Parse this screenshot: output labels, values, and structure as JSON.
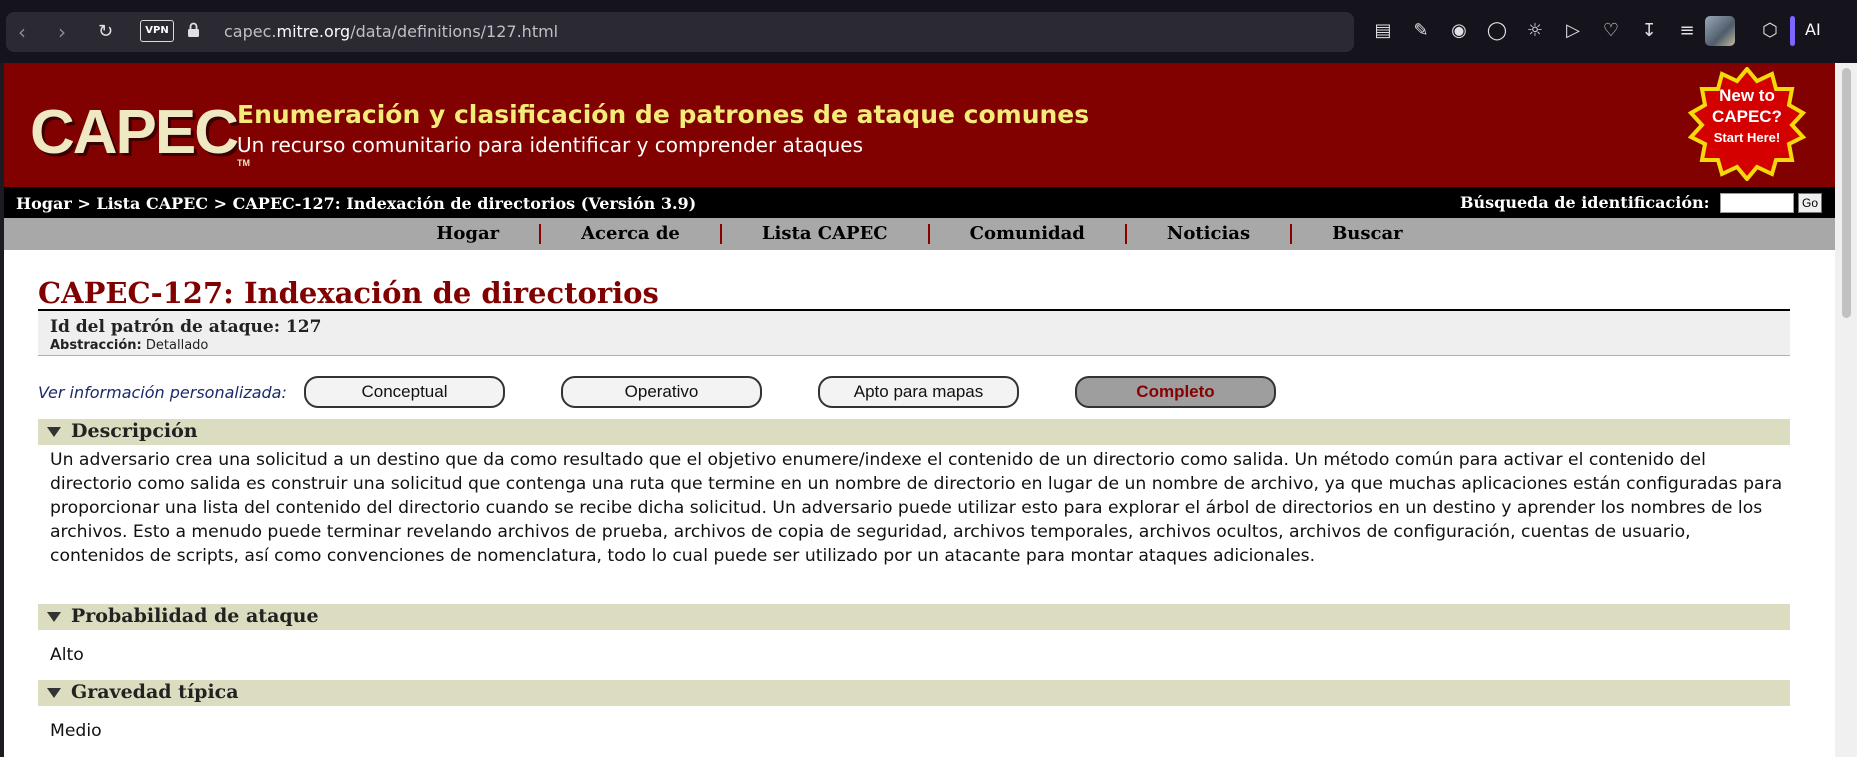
{
  "browser": {
    "url_prefix": "capec.",
    "url_domain": "mitre.org",
    "url_path": "/data/definitions/127.html",
    "vpn_label": "VPN",
    "ai_label": "AI"
  },
  "banner": {
    "logo": "CAPEC",
    "logo_tm": "TM",
    "title": "Enumeración y clasificación de patrones de ataque comunes",
    "subtitle": "Un recurso comunitario para identificar y comprender ataques",
    "badge_line1": "New to",
    "badge_line2": "CAPEC?",
    "badge_line3": "Start Here!"
  },
  "breadcrumb": {
    "text": "Hogar > Lista CAPEC > CAPEC-127: Indexación de directorios (Versión 3.9)",
    "id_search_label": "Búsqueda de identificación:",
    "go_label": "Go"
  },
  "nav": {
    "items": [
      "Hogar",
      "Acerca de",
      "Lista CAPEC",
      "Comunidad",
      "Noticias",
      "Buscar"
    ]
  },
  "main": {
    "title": "CAPEC-127: Indexación de directorios",
    "id_line": "Id del patrón de ataque: 127",
    "abstraction_label": "Abstracción:",
    "abstraction_value": "Detallado",
    "view_label": "Ver información personalizada:",
    "views": [
      "Conceptual",
      "Operativo",
      "Apto para mapas",
      "Completo"
    ],
    "active_view": "Completo",
    "sections": {
      "description_title": "Descripción",
      "description_text": "Un adversario crea una solicitud a un destino que da como resultado que el objetivo enumere/indexe el contenido de un directorio como salida. Un método común para activar el contenido del directorio como salida es construir una solicitud que contenga una ruta que termine en un nombre de directorio en lugar de un nombre de archivo, ya que muchas aplicaciones están configuradas para proporcionar una lista del contenido del directorio cuando se recibe dicha solicitud. Un adversario puede utilizar esto para explorar el árbol de directorios en un destino y aprender los nombres de los archivos. Esto a menudo puede terminar revelando archivos de prueba, archivos de copia de seguridad, archivos temporales, archivos ocultos, archivos de configuración, cuentas de usuario, contenidos de scripts, así como convenciones de nomenclatura, todo lo cual puede ser utilizado por un atacante para montar ataques adicionales.",
      "likelihood_title": "Probabilidad de ataque",
      "likelihood_value": "Alto",
      "severity_title": "Gravedad típica",
      "severity_value": "Medio"
    }
  },
  "colors": {
    "banner": "#810000",
    "title_yellow": "#f4ec7a",
    "section_bg": "#dcdcc0",
    "nav_bg": "#a8a8a8"
  }
}
